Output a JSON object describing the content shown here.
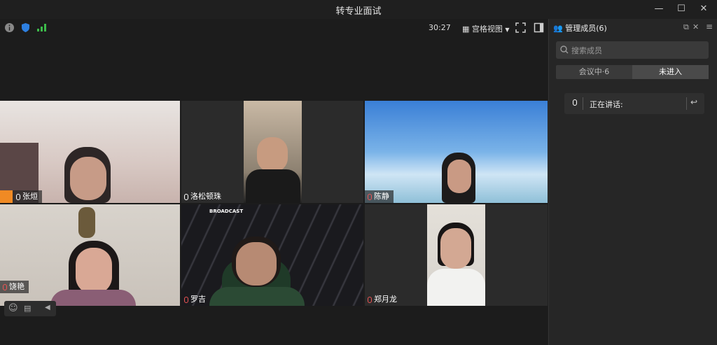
{
  "window": {
    "title": "转专业面试"
  },
  "toolbar": {
    "timer": "30:27",
    "view_label": "宫格视图"
  },
  "panel": {
    "header": "管理成员(6)",
    "search_placeholder": "搜索成员",
    "tabs": [
      "会议中·6",
      "未进入"
    ],
    "speaking_label": "正在讲话:"
  },
  "participants": [
    {
      "name": "张烜"
    },
    {
      "name": "洛松顿珠"
    },
    {
      "name": "陈静"
    },
    {
      "name": "饶艳"
    },
    {
      "name": "罗吉"
    },
    {
      "name": "郑月龙"
    }
  ],
  "video_overlays": {
    "broadcast_label": "BROADCAST"
  }
}
